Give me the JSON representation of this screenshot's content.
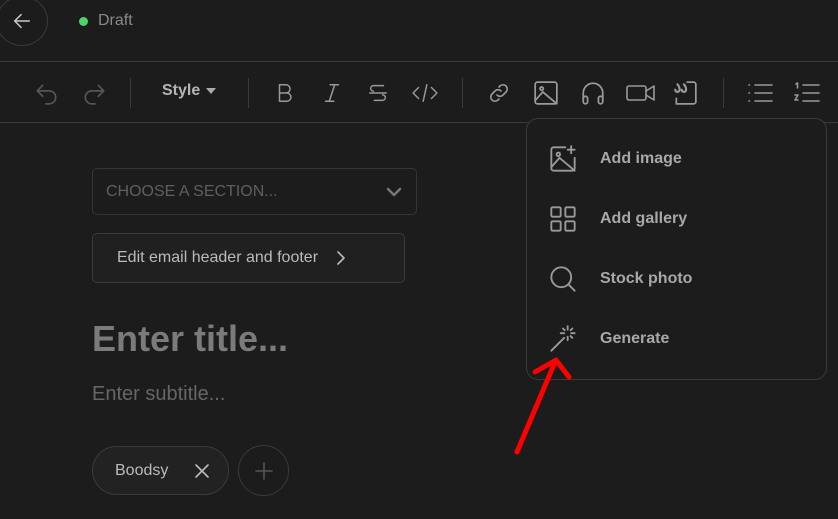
{
  "header": {
    "status": "Draft",
    "status_color": "#4cd26b"
  },
  "toolbar": {
    "style_label": "Style"
  },
  "editor": {
    "section_placeholder": "CHOOSE A SECTION...",
    "edit_header_footer": "Edit email header and footer",
    "title_placeholder": "Enter title...",
    "subtitle_placeholder": "Enter subtitle...",
    "tags": [
      "Boodsy"
    ]
  },
  "menu": {
    "items": [
      {
        "label": "Add image",
        "icon": "image-plus-icon"
      },
      {
        "label": "Add gallery",
        "icon": "grid-icon"
      },
      {
        "label": "Stock photo",
        "icon": "search-icon"
      },
      {
        "label": "Generate",
        "icon": "magic-wand-icon"
      }
    ]
  },
  "annotation_color": "#ff0000"
}
